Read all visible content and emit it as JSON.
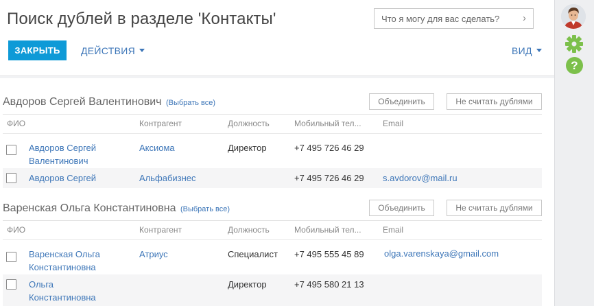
{
  "header": {
    "title": "Поиск дублей в разделе 'Контакты'",
    "assistant_placeholder": "Что я могу для вас сделать?",
    "close_label": "ЗАКРЫТЬ",
    "actions_label": "ДЕЙСТВИЯ",
    "view_label": "ВИД"
  },
  "columns": {
    "name": "ФИО",
    "account": "Контрагент",
    "job": "Должность",
    "mobile": "Мобильный тел...",
    "email": "Email"
  },
  "groups": [
    {
      "title": "Авдоров Сергей Валентинович",
      "select_all": "(Выбрать все)",
      "merge_label": "Объединить",
      "not_dup_label": "Не считать дублями",
      "rows": [
        {
          "name_line1": "Авдоров Сергей",
          "name_line2": "Валентинович",
          "account": "Аксиома",
          "job": "Директор",
          "mobile": "+7 495 726 46 29",
          "email": ""
        },
        {
          "name_line1": "Авдоров Сергей",
          "name_line2": "",
          "account": "Альфабизнес",
          "job": "",
          "mobile": "+7 495 726 46 29",
          "email": "s.avdorov@mail.ru"
        }
      ]
    },
    {
      "title": "Варенская Ольга Константиновна",
      "select_all": "(Выбрать все)",
      "merge_label": "Объединить",
      "not_dup_label": "Не считать дублями",
      "rows": [
        {
          "name_line1": "Варенская Ольга",
          "name_line2": "Константиновна",
          "account": "Атриус",
          "job": "Специалист",
          "mobile": "+7 495 555 45 89",
          "email": "olga.varenskaya@gmail.com"
        },
        {
          "name_line1": "Ольга",
          "name_line2": "Константиновна",
          "account": "",
          "job": "Директор",
          "mobile": "+7 495 580 21 13",
          "email": ""
        }
      ]
    }
  ],
  "sidebar": {
    "icons": [
      "avatar",
      "gear-icon",
      "help-icon"
    ],
    "help_glyph": "?"
  },
  "colors": {
    "accent": "#0e9ad7",
    "link": "#3d76b8",
    "gear": "#7cc04b",
    "help": "#7cc04b"
  }
}
